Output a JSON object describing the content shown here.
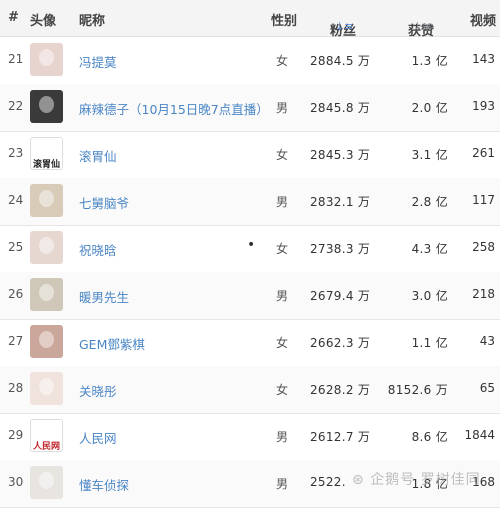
{
  "header": {
    "rank": "#",
    "avatar": "头像",
    "name": "昵称",
    "gender": "性别",
    "fans": "粉丝",
    "likes": "获赞",
    "videos": "视频"
  },
  "rows": [
    {
      "rank": "21",
      "name": "冯提莫",
      "gender": "女",
      "fans": "2884.5 万",
      "likes": "1.3 亿",
      "videos": "143",
      "avatar_color": "#e8d4cf"
    },
    {
      "rank": "22",
      "name": "麻辣德子（10月15日晚7点直播）",
      "gender": "男",
      "fans": "2845.8 万",
      "likes": "2.0 亿",
      "videos": "193",
      "avatar_color": "#3a3a3a"
    },
    {
      "rank": "23",
      "name": "滚胃仙",
      "gender": "女",
      "fans": "2845.3 万",
      "likes": "3.1 亿",
      "videos": "261",
      "avatar_color": "#ffffff",
      "avatar_text": "滚胃仙"
    },
    {
      "rank": "24",
      "name": "七舅脑爷",
      "gender": "男",
      "fans": "2832.1 万",
      "likes": "2.8 亿",
      "videos": "117",
      "avatar_color": "#d8cbb8"
    },
    {
      "rank": "25",
      "name": "祝晓晗",
      "gender": "女",
      "fans": "2738.3 万",
      "likes": "4.3 亿",
      "videos": "258",
      "avatar_color": "#e6d8d0",
      "extra": "•"
    },
    {
      "rank": "26",
      "name": "暖男先生",
      "gender": "男",
      "fans": "2679.4 万",
      "likes": "3.0 亿",
      "videos": "218",
      "avatar_color": "#cfc8b8"
    },
    {
      "rank": "27",
      "name": "GEM鄧紫棋",
      "gender": "女",
      "fans": "2662.3 万",
      "likes": "1.1 亿",
      "videos": "43",
      "avatar_color": "#caa79a"
    },
    {
      "rank": "28",
      "name": "关晓彤",
      "gender": "女",
      "fans": "2628.2 万",
      "likes": "8152.6 万",
      "videos": "65",
      "avatar_color": "#f0e2dc"
    },
    {
      "rank": "29",
      "name": "人民网",
      "gender": "男",
      "fans": "2612.7 万",
      "likes": "8.6 亿",
      "videos": "1844",
      "avatar_color": "#ffffff",
      "avatar_text": "人民网"
    },
    {
      "rank": "30",
      "name": "懂车侦探",
      "gender": "男",
      "fans": "2522.",
      "likes": "1.8 亿",
      "videos": "168",
      "avatar_color": "#e8e4e0"
    }
  ],
  "watermark": "企鹅号 罗树佳同",
  "colors": {
    "link": "#4a86c5",
    "sort_active": "#5b8fd6",
    "header_bg": "#f4f4f4"
  }
}
